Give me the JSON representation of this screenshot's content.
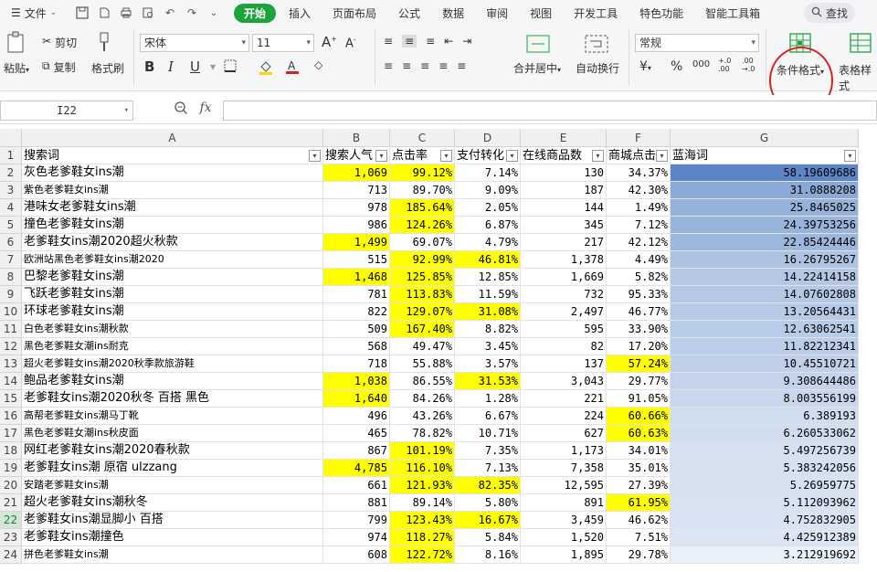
{
  "menubar": {
    "file_label": "文件",
    "tabs": [
      "开始",
      "插入",
      "页面布局",
      "公式",
      "数据",
      "审阅",
      "视图",
      "开发工具",
      "特色功能",
      "智能工具箱"
    ],
    "active_tab": "开始",
    "search_label": "查找"
  },
  "ribbon": {
    "paste_label": "粘贴",
    "cut_label": "剪切",
    "copy_label": "复制",
    "format_painter_label": "格式刷",
    "font_name": "宋体",
    "font_size": "11",
    "bold": "B",
    "italic": "I",
    "underline": "U",
    "merge_center_label": "合并居中",
    "wrap_label": "自动换行",
    "number_format": "常规",
    "currency_symbol": "¥",
    "percent_symbol": "%",
    "thousand_sep": "000",
    "inc_decimal": "+.0 .00",
    "dec_decimal": ".00 →.0",
    "conditional_format_label": "条件格式",
    "table_style_label": "表格样式"
  },
  "formula_bar": {
    "cell_ref": "I22",
    "fx_label": "fx",
    "formula_value": ""
  },
  "columns": {
    "letters": [
      "A",
      "B",
      "C",
      "D",
      "E",
      "F",
      "G"
    ],
    "headers": [
      "搜索词",
      "搜索人气",
      "点击率",
      "支付转化",
      "在线商品数",
      "商城点击",
      "蓝海词"
    ]
  },
  "rows": [
    {
      "n": "1"
    },
    {
      "n": "2",
      "a": "灰色老爹鞋女ins潮",
      "b": "1,069",
      "c": "99.12%",
      "d": "7.14%",
      "e": "130",
      "f": "34.37%",
      "g": "58.19609686",
      "hb": true,
      "hc": true,
      "hd": false,
      "hf": false,
      "small": false
    },
    {
      "n": "3",
      "a": "紫色老爹鞋女ins潮",
      "b": "713",
      "c": "89.70%",
      "d": "9.09%",
      "e": "187",
      "f": "42.30%",
      "g": "31.0888208",
      "hb": false,
      "hc": false,
      "hd": false,
      "hf": false,
      "small": true
    },
    {
      "n": "4",
      "a": "港味女老爹鞋女ins潮",
      "b": "978",
      "c": "185.64%",
      "d": "2.05%",
      "e": "144",
      "f": "1.49%",
      "g": "25.8465025",
      "hb": false,
      "hc": true,
      "hd": false,
      "hf": false,
      "small": false
    },
    {
      "n": "5",
      "a": "撞色老爹鞋女ins潮",
      "b": "986",
      "c": "124.26%",
      "d": "6.87%",
      "e": "345",
      "f": "7.12%",
      "g": "24.39753256",
      "hb": false,
      "hc": true,
      "hd": false,
      "hf": false,
      "small": false
    },
    {
      "n": "6",
      "a": "老爹鞋女ins潮2020超火秋款",
      "b": "1,499",
      "c": "69.07%",
      "d": "4.79%",
      "e": "217",
      "f": "42.12%",
      "g": "22.85424446",
      "hb": true,
      "hc": false,
      "hd": false,
      "hf": false,
      "small": false
    },
    {
      "n": "7",
      "a": "欧洲站黑色老爹鞋女ins潮2020",
      "b": "515",
      "c": "92.99%",
      "d": "46.81%",
      "e": "1,378",
      "f": "4.49%",
      "g": "16.26795267",
      "hb": false,
      "hc": true,
      "hd": true,
      "hf": false,
      "small": true
    },
    {
      "n": "8",
      "a": "巴黎老爹鞋女ins潮",
      "b": "1,468",
      "c": "125.85%",
      "d": "12.85%",
      "e": "1,669",
      "f": "5.82%",
      "g": "14.22414158",
      "hb": true,
      "hc": true,
      "hd": false,
      "hf": false,
      "small": false
    },
    {
      "n": "9",
      "a": "飞跃老爹鞋女ins潮",
      "b": "781",
      "c": "113.83%",
      "d": "11.59%",
      "e": "732",
      "f": "95.33%",
      "g": "14.07602808",
      "hb": false,
      "hc": true,
      "hd": false,
      "hf": false,
      "small": false
    },
    {
      "n": "10",
      "a": "环球老爹鞋女ins潮",
      "b": "822",
      "c": "129.07%",
      "d": "31.08%",
      "e": "2,497",
      "f": "46.77%",
      "g": "13.20564431",
      "hb": false,
      "hc": true,
      "hd": true,
      "hf": false,
      "small": false
    },
    {
      "n": "11",
      "a": "白色老爹鞋女ins潮秋款",
      "b": "509",
      "c": "167.40%",
      "d": "8.82%",
      "e": "595",
      "f": "33.90%",
      "g": "12.63062541",
      "hb": false,
      "hc": true,
      "hd": false,
      "hf": false,
      "small": true
    },
    {
      "n": "12",
      "a": "黑色老爹鞋女潮ins耐克",
      "b": "568",
      "c": "49.47%",
      "d": "3.45%",
      "e": "82",
      "f": "17.20%",
      "g": "11.82212341",
      "hb": false,
      "hc": false,
      "hd": false,
      "hf": false,
      "small": true
    },
    {
      "n": "13",
      "a": "超火老爹鞋女ins潮2020秋季款旅游鞋",
      "b": "718",
      "c": "55.88%",
      "d": "3.57%",
      "e": "137",
      "f": "57.24%",
      "g": "10.45510721",
      "hb": false,
      "hc": false,
      "hd": false,
      "hf": true,
      "small": true
    },
    {
      "n": "14",
      "a": "鲍品老爹鞋女ins潮",
      "b": "1,038",
      "c": "86.55%",
      "d": "31.53%",
      "e": "3,043",
      "f": "29.77%",
      "g": "9.308644486",
      "hb": true,
      "hc": false,
      "hd": true,
      "hf": false,
      "small": false
    },
    {
      "n": "15",
      "a": "老爹鞋女ins潮2020秋冬 百搭 黑色",
      "b": "1,640",
      "c": "84.26%",
      "d": "1.28%",
      "e": "221",
      "f": "91.05%",
      "g": "8.003556199",
      "hb": true,
      "hc": false,
      "hd": false,
      "hf": false,
      "small": false
    },
    {
      "n": "16",
      "a": "高帮老爹鞋女ins潮马丁靴",
      "b": "496",
      "c": "43.26%",
      "d": "6.67%",
      "e": "224",
      "f": "60.66%",
      "g": "6.389193",
      "hb": false,
      "hc": false,
      "hd": false,
      "hf": true,
      "small": true
    },
    {
      "n": "17",
      "a": "黑色老爹鞋女潮ins秋皮面",
      "b": "465",
      "c": "78.82%",
      "d": "10.71%",
      "e": "627",
      "f": "60.63%",
      "g": "6.260533062",
      "hb": false,
      "hc": false,
      "hd": false,
      "hf": true,
      "small": true
    },
    {
      "n": "18",
      "a": "网红老爹鞋女ins潮2020春秋款",
      "b": "867",
      "c": "101.19%",
      "d": "7.35%",
      "e": "1,173",
      "f": "34.01%",
      "g": "5.497256739",
      "hb": false,
      "hc": true,
      "hd": false,
      "hf": false,
      "small": false
    },
    {
      "n": "19",
      "a": "老爹鞋女ins潮 原宿 ulzzang",
      "b": "4,785",
      "c": "116.10%",
      "d": "7.13%",
      "e": "7,358",
      "f": "35.01%",
      "g": "5.383242056",
      "hb": true,
      "hc": true,
      "hd": false,
      "hf": false,
      "small": false
    },
    {
      "n": "20",
      "a": "安踏老爹鞋女ins潮",
      "b": "661",
      "c": "121.93%",
      "d": "82.35%",
      "e": "12,595",
      "f": "27.39%",
      "g": "5.26959775",
      "hb": false,
      "hc": true,
      "hd": true,
      "hf": false,
      "small": true
    },
    {
      "n": "21",
      "a": "超火老爹鞋女ins潮秋冬",
      "b": "881",
      "c": "89.14%",
      "d": "5.80%",
      "e": "891",
      "f": "61.95%",
      "g": "5.112093962",
      "hb": false,
      "hc": false,
      "hd": false,
      "hf": true,
      "small": false
    },
    {
      "n": "22",
      "a": "老爹鞋女ins潮显脚小 百搭",
      "b": "799",
      "c": "123.43%",
      "d": "16.67%",
      "e": "3,459",
      "f": "46.62%",
      "g": "4.752832905",
      "hb": false,
      "hc": true,
      "hd": true,
      "hf": false,
      "small": false
    },
    {
      "n": "23",
      "a": "老爹鞋女ins潮撞色",
      "b": "974",
      "c": "118.27%",
      "d": "5.84%",
      "e": "1,520",
      "f": "7.51%",
      "g": "4.425912389",
      "hb": false,
      "hc": true,
      "hd": false,
      "hf": false,
      "small": false
    },
    {
      "n": "24",
      "a": "拼色老爹鞋女ins潮",
      "b": "608",
      "c": "122.72%",
      "d": "8.16%",
      "e": "1,895",
      "f": "29.78%",
      "g": "3.212919692",
      "hb": false,
      "hc": true,
      "hd": false,
      "hf": false,
      "small": true
    }
  ],
  "colors": {
    "accent": "#1da33e",
    "highlight": "#ffff00",
    "databar_dark": "#5b85c4",
    "databar_light": "#eaf0f9",
    "annotation_circle": "#e02020"
  }
}
